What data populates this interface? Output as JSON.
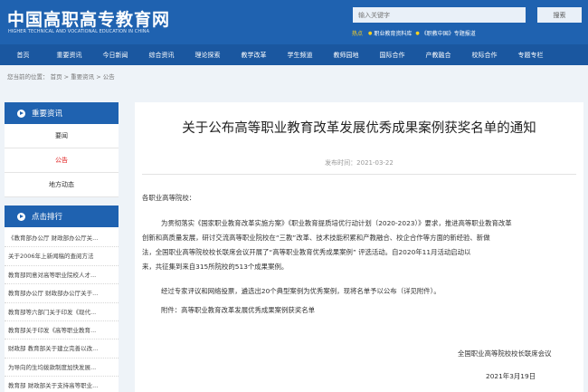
{
  "header": {
    "logo_cn": "中国高职高专教育网",
    "logo_en": "HIGHER TECHNICAL AND VOCATIONAL EDUCATION IN CHINA",
    "search_placeholder": "输入关键字",
    "search_button": "搜索",
    "hot_label": "热点",
    "hot_links": [
      "职业教育资料库",
      "《职教中国》专题报道"
    ]
  },
  "nav": [
    "首页",
    "重要资讯",
    "今日新闻",
    "综合资讯",
    "理论探索",
    "教学改革",
    "学生频道",
    "教师园地",
    "国际合作",
    "产教融合",
    "校际合作",
    "专题专栏"
  ],
  "breadcrumb": "您当前的位置： 首页 > 重要资讯 > 公告",
  "sidebar": {
    "section_title": "重要资讯",
    "links": [
      {
        "label": "要闻",
        "active": false
      },
      {
        "label": "公告",
        "active": true
      },
      {
        "label": "地方动态",
        "active": false
      }
    ],
    "rank_title": "点击排行",
    "rank_items": [
      "《教育部办公厅 财政部办公厅关...",
      "关于2006年上新闻稿的查阅方法",
      "教育部同意对高等职业院校人才...",
      "教育部办公厅 财政部办公厅关于...",
      "教育部等六部门关于印发《现代...",
      "教育部关于印发《高等职业教育...",
      "财政部 教育部关于建立完善以改...",
      "为导向的生均拨款制度加快发展...",
      "教育部 财政部关于支持高等职业..."
    ]
  },
  "article": {
    "title": "关于公布高等职业教育改革发展优秀成果案例获奖名单的通知",
    "pub_date": "发布时间：2021-03-22",
    "salutation": "各职业高等院校：",
    "body_lines": [
      "为贯彻落实《国家职业教育改革实施方案》《职业教育提质培优行动计划（2020-2023）》要求，推进高等职业教育改革",
      "创新和高质量发展，研讨交流高等职业院校在“三教”改革、技术技能积累和产教融合、校企合作等方面的新经验、新做",
      "法，全国职业高等院校校长联席会议开展了“高等职业教育优秀成果案例” 评选活动。自2020年11月活动启动以",
      "来，共征集到来自315所院校的513个成果案例。"
    ],
    "para2": "经过专家评议和网络投票，遴选出20个典型案例为优秀案例，现将名单予以公布（详见附件）。",
    "attachment": "附件：高等职业教育改革发展优秀成果案例获奖名单",
    "signature": "全国职业高等院校校长联席会议",
    "sign_date": "2021年3月19日"
  }
}
